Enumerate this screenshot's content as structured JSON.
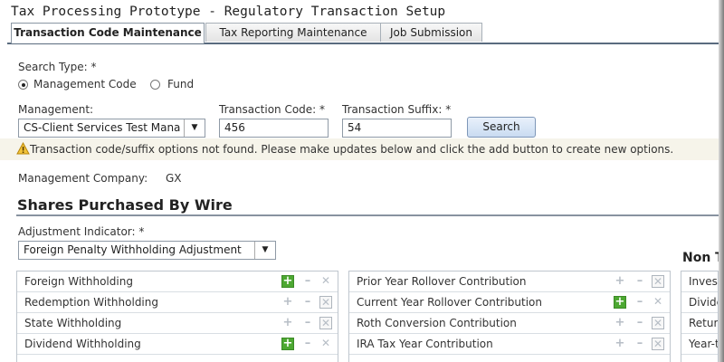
{
  "app": {
    "title": "Tax Processing Prototype - Regulatory Transaction Setup"
  },
  "tabs": [
    {
      "label": "Transaction Code Maintenance",
      "active": true
    },
    {
      "label": "Tax Reporting Maintenance",
      "active": false
    },
    {
      "label": "Job Submission",
      "active": false
    }
  ],
  "search": {
    "type_label": "Search Type: *",
    "option_management": "Management Code",
    "option_fund": "Fund",
    "selected": "Management Code",
    "management_label": "Management:",
    "management_value": "CS-Client Services Test Mana",
    "transaction_code_label": "Transaction Code: *",
    "transaction_code_value": "456",
    "transaction_suffix_label": "Transaction Suffix: *",
    "transaction_suffix_value": "54",
    "search_button": "Search"
  },
  "warning": {
    "text": "Transaction code/suffix options not found. Please make updates below and click the add button to create new options."
  },
  "company": {
    "label": "Management Company:",
    "value": "GX"
  },
  "section": {
    "title": "Shares Purchased By Wire",
    "adjustment_label": "Adjustment Indicator: *",
    "adjustment_value": "Foreign Penalty Withholding Adjustment",
    "non_label": "Non T"
  },
  "lists": {
    "left": [
      {
        "label": "Foreign Withholding",
        "add_active": true,
        "remove_boxed": false
      },
      {
        "label": "Redemption Withholding",
        "add_active": false,
        "remove_boxed": true
      },
      {
        "label": "State Withholding",
        "add_active": false,
        "remove_boxed": true
      },
      {
        "label": "Dividend Withholding",
        "add_active": true,
        "remove_boxed": false
      }
    ],
    "middle": [
      {
        "label": "Prior Year Rollover Contribution",
        "add_active": false,
        "remove_boxed": true
      },
      {
        "label": "Current Year Rollover Contribution",
        "add_active": true,
        "remove_boxed": false
      },
      {
        "label": "Roth Conversion Contribution",
        "add_active": false,
        "remove_boxed": true
      },
      {
        "label": "IRA Tax Year Contribution",
        "add_active": false,
        "remove_boxed": true
      }
    ],
    "right": [
      {
        "label": "Invest"
      },
      {
        "label": "Divide"
      },
      {
        "label": "Return"
      },
      {
        "label": "Year-t"
      }
    ]
  },
  "colors": {
    "accent_add": "#4da832",
    "tab_border": "#5a6b7f",
    "warning_bg": "#f6f4ea"
  }
}
